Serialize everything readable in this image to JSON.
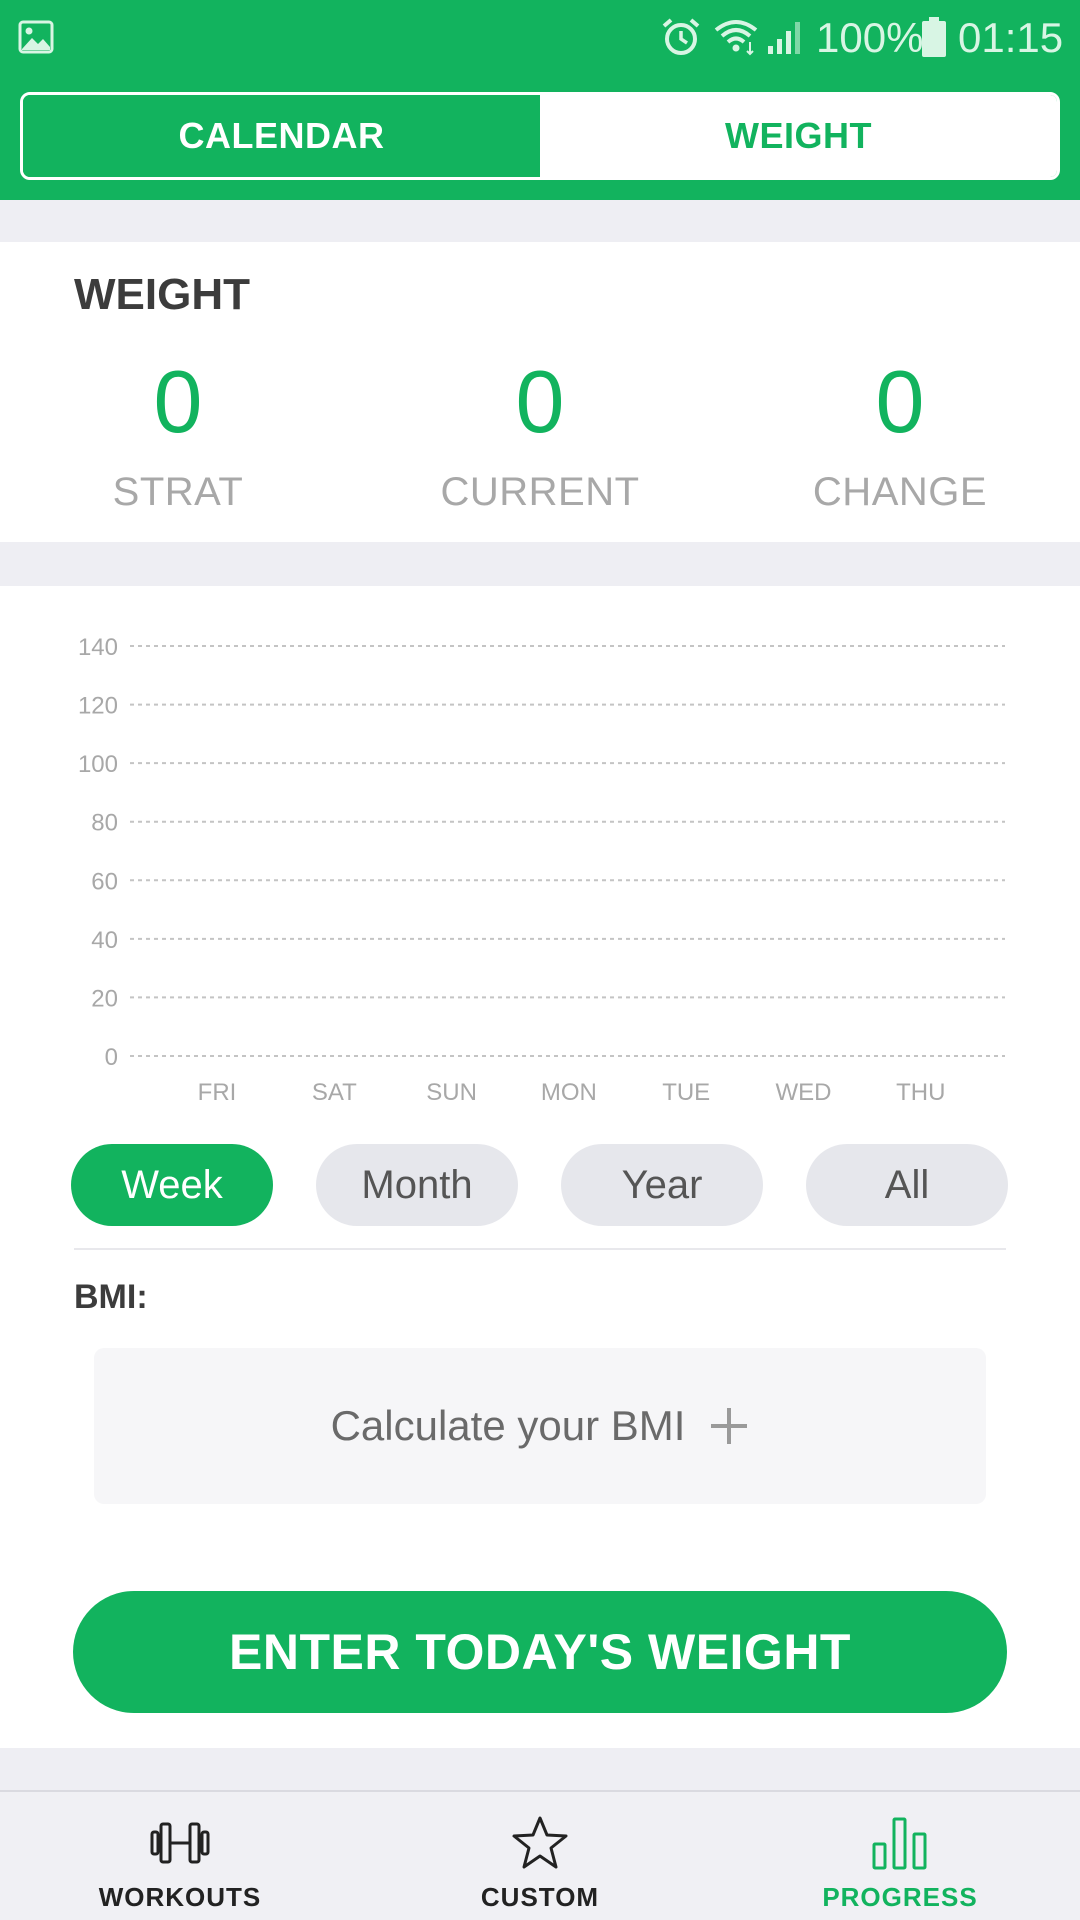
{
  "status_bar": {
    "battery_percent": "100%",
    "time": "01:15",
    "icons": [
      "gallery-icon",
      "alarm-icon",
      "wifi-icon",
      "signal-icon",
      "battery-icon"
    ]
  },
  "tabs": {
    "calendar": "CALENDAR",
    "weight": "WEIGHT",
    "active": "CALENDAR"
  },
  "weight_card": {
    "title": "WEIGHT",
    "stats": [
      {
        "value": "0",
        "label": "STRAT"
      },
      {
        "value": "0",
        "label": "CURRENT"
      },
      {
        "value": "0",
        "label": "CHANGE"
      }
    ]
  },
  "chart_data": {
    "type": "line",
    "categories": [
      "FRI",
      "SAT",
      "SUN",
      "MON",
      "TUE",
      "WED",
      "THU"
    ],
    "series": [],
    "y_ticks": [
      "140",
      "120",
      "100",
      "80",
      "60",
      "40",
      "20",
      "0"
    ],
    "ylim": [
      0,
      140
    ],
    "grid": true
  },
  "ranges": {
    "options": [
      "Week",
      "Month",
      "Year",
      "All"
    ],
    "selected": "Week"
  },
  "bmi": {
    "label": "BMI:",
    "prompt": "Calculate your BMI"
  },
  "cta_label": "ENTER TODAY'S WEIGHT",
  "bottom_nav": {
    "items": [
      {
        "label": "WORKOUTS",
        "icon": "dumbbell-icon"
      },
      {
        "label": "CUSTOM",
        "icon": "star-icon"
      },
      {
        "label": "PROGRESS",
        "icon": "bar-chart-icon"
      }
    ],
    "active": "PROGRESS"
  },
  "colors": {
    "accent": "#12b35e",
    "background": "#eeeef3",
    "card": "#ffffff"
  }
}
